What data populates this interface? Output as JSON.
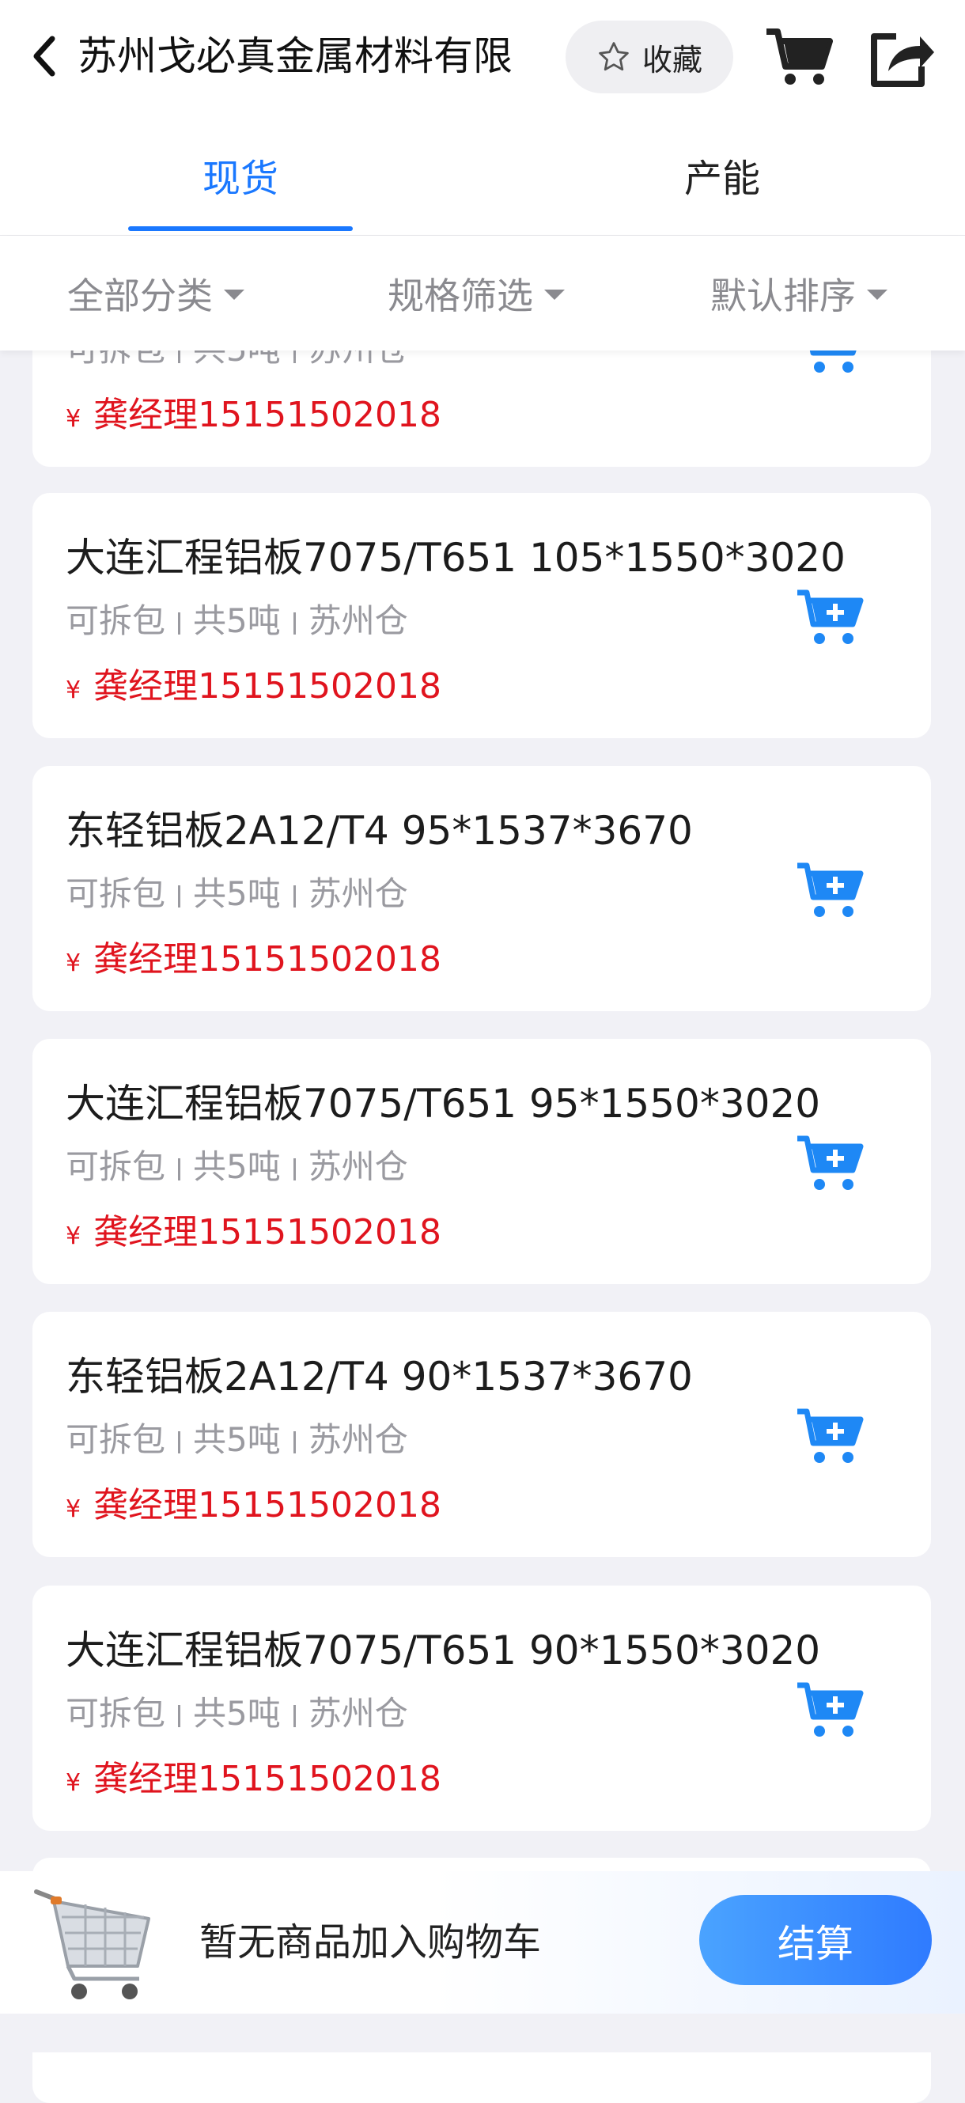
{
  "header": {
    "title": "苏州戈必真金属材料有限",
    "favorite_label": "收藏"
  },
  "tabs": [
    {
      "label": "现货",
      "active": true
    },
    {
      "label": "产能",
      "active": false
    }
  ],
  "filters": [
    {
      "label": "全部分类"
    },
    {
      "label": "规格筛选"
    },
    {
      "label": "默认排序"
    }
  ],
  "products": [
    {
      "name": "",
      "meta": [
        "可拆包",
        "共5吨",
        "苏州仓"
      ],
      "contact": "龚经理15151502018"
    },
    {
      "name": "大连汇程铝板7075/T651 105*1550*3020",
      "meta": [
        "可拆包",
        "共5吨",
        "苏州仓"
      ],
      "contact": "龚经理15151502018"
    },
    {
      "name": "东轻铝板2A12/T4 95*1537*3670",
      "meta": [
        "可拆包",
        "共5吨",
        "苏州仓"
      ],
      "contact": "龚经理15151502018"
    },
    {
      "name": "大连汇程铝板7075/T651 95*1550*3020",
      "meta": [
        "可拆包",
        "共5吨",
        "苏州仓"
      ],
      "contact": "龚经理15151502018"
    },
    {
      "name": "东轻铝板2A12/T4 90*1537*3670",
      "meta": [
        "可拆包",
        "共5吨",
        "苏州仓"
      ],
      "contact": "龚经理15151502018"
    },
    {
      "name": "大连汇程铝板7075/T651 90*1550*3020",
      "meta": [
        "可拆包",
        "共5吨",
        "苏州仓"
      ],
      "contact": "龚经理15151502018"
    }
  ],
  "price_symbol": "¥",
  "bottom_bar": {
    "empty_text": "暂无商品加入购物车",
    "checkout_label": "结算"
  },
  "colors": {
    "accent": "#1a78ff",
    "price": "#e0141e",
    "cart_icon": "#1e88f5"
  }
}
